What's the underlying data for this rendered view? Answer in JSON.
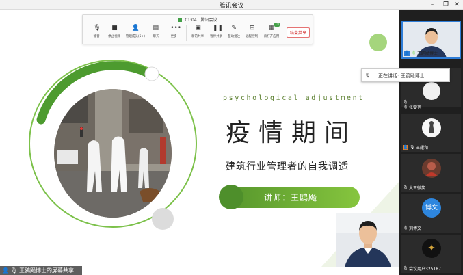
{
  "window": {
    "title": "腾讯会议"
  },
  "toolbar": {
    "status_time": "01:04",
    "status_text": "腾讯会议",
    "items": [
      {
        "label": "静音",
        "icon": "mic-icon"
      },
      {
        "label": "停止视频",
        "icon": "camera-icon"
      },
      {
        "label": "管理成员(5+)",
        "icon": "members-icon"
      },
      {
        "label": "聊天",
        "icon": "chat-icon"
      },
      {
        "label": "更多",
        "icon": "more-icon"
      },
      {
        "label": "新的共享",
        "icon": "share-icon"
      },
      {
        "label": "暂停共享",
        "icon": "pause-icon"
      },
      {
        "label": "互动批注",
        "icon": "annotate-icon"
      },
      {
        "label": "远程控制",
        "icon": "remote-icon"
      },
      {
        "label": "云打开应用",
        "icon": "apps-icon",
        "badge": "1s"
      }
    ],
    "stop_label": "结束共享"
  },
  "slide": {
    "subtitle_en": "psychological adjustment",
    "title": "疫情期间",
    "subtitle": "建筑行业管理者的自我调适",
    "lecturer": "讲师：王鸥飏",
    "colors": {
      "green_dark": "#4e8f2b",
      "green_light": "#86c53e",
      "ring": "#5aa332"
    }
  },
  "share_status": {
    "label": "王鸥飏博士的屏幕共享"
  },
  "speaking": {
    "text": "正在讲话: 王鸥飏博士"
  },
  "participants": [
    {
      "name": "王鸥飏博士",
      "type": "video",
      "active": true
    },
    {
      "name": "",
      "type": "avatar"
    },
    {
      "name": "张雯蓓",
      "type": "avatar"
    },
    {
      "name": "王耀和",
      "type": "avatar"
    },
    {
      "name": "大王微笑",
      "type": "avatar"
    },
    {
      "name": "刘博文",
      "type": "avatar",
      "initials": "博文"
    },
    {
      "name": "会议用户325187",
      "type": "avatar"
    }
  ]
}
